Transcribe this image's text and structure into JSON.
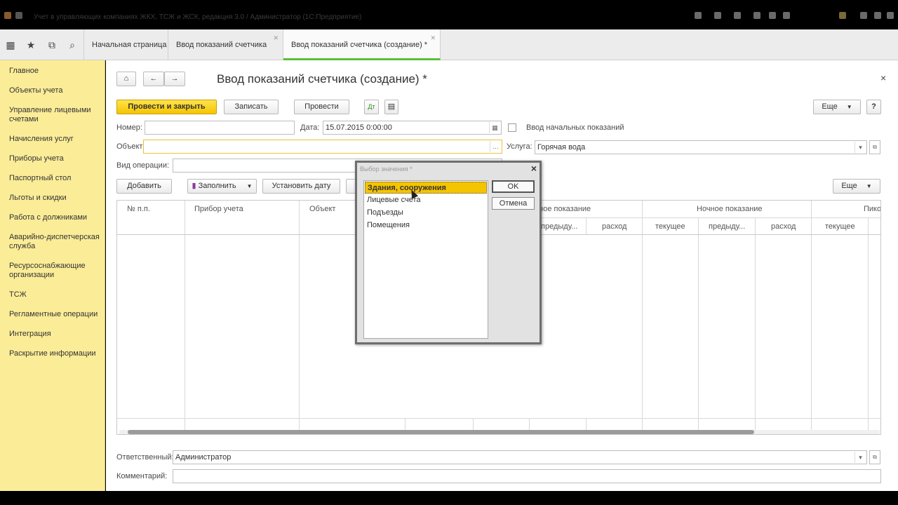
{
  "window": {
    "title": "Учет в управляющих компаниях ЖКХ, ТСЖ и ЖСК, редакция 3.0 / Администратор (1С:Предприятие)"
  },
  "tabs": [
    {
      "label": "Начальная страница"
    },
    {
      "label": "Ввод показаний счетчика"
    },
    {
      "label": "Ввод показаний счетчика (создание) *"
    }
  ],
  "sidebar": {
    "items": [
      {
        "label": "Главное"
      },
      {
        "label": "Объекты учета"
      },
      {
        "label": "Управление лицевыми счетами"
      },
      {
        "label": "Начисления услуг"
      },
      {
        "label": "Приборы учета"
      },
      {
        "label": "Паспортный стол"
      },
      {
        "label": "Льготы и скидки"
      },
      {
        "label": "Работа с должниками"
      },
      {
        "label": "Аварийно-диспетчерская служба"
      },
      {
        "label": "Ресурсоснабжающие организации"
      },
      {
        "label": "ТСЖ"
      },
      {
        "label": "Регламентные операции"
      },
      {
        "label": "Интеграция"
      },
      {
        "label": "Раскрытие информации"
      }
    ]
  },
  "form": {
    "title": "Ввод показаний счетчика (создание) *",
    "close": "×",
    "buttons": {
      "post_close": "Провести и закрыть",
      "save": "Записать",
      "post": "Провести",
      "more": "Еще",
      "help": "?"
    },
    "number_label": "Номер:",
    "number_value": "",
    "date_label": "Дата:",
    "date_value": "15.07.2015  0:00:00",
    "initial_label": "Ввод начальных показаний",
    "object_label": "Объект:",
    "object_value": "",
    "service_label": "Услуга:",
    "service_value": "Горячая вода",
    "operation_label": "Вид операции:",
    "operation_value": "",
    "table_buttons": {
      "add": "Добавить",
      "fill": "Заполнить",
      "set_date": "Установить дату",
      "more": "Еще"
    },
    "responsible_label": "Ответственный:",
    "responsible_value": "Администратор",
    "comment_label": "Комментарий:",
    "comment_value": ""
  },
  "grid": {
    "headers": {
      "num": "№ п.п.",
      "device": "Прибор учета",
      "object": "Объект",
      "day_group": "...ное показание",
      "night_group": "Ночное показание",
      "peak_group": "Пико"
    },
    "sub": {
      "prev1": "предыду...",
      "consumption1": "расход",
      "current2": "текущее",
      "prev2": "предыду...",
      "consumption2": "расход",
      "current3": "текущее"
    }
  },
  "dialog": {
    "title": "Выбор значения *",
    "items": [
      {
        "label": "Здания, сооружения",
        "selected": true
      },
      {
        "label": "Лицевые счета"
      },
      {
        "label": "Подъезды"
      },
      {
        "label": "Помещения"
      }
    ],
    "ok": "OK",
    "cancel": "Отмена"
  }
}
